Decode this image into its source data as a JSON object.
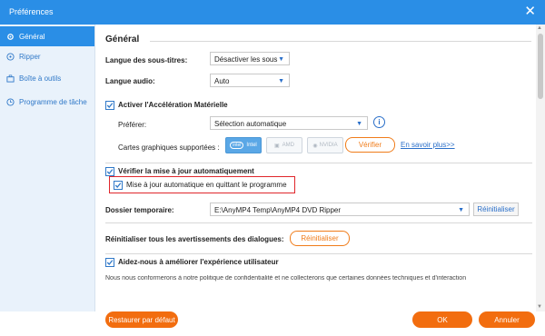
{
  "window": {
    "title": "Préférences",
    "close_icon": "close-icon"
  },
  "sidebar": {
    "items": [
      {
        "label": "Général",
        "icon": "gear-icon",
        "active": true
      },
      {
        "label": "Ripper",
        "icon": "disc-icon",
        "active": false
      },
      {
        "label": "Boîte à outils",
        "icon": "toolbox-icon",
        "active": false
      },
      {
        "label": "Programme de tâche",
        "icon": "clock-icon",
        "active": false
      }
    ]
  },
  "general": {
    "section_title": "Général",
    "subtitle_lang_label": "Langue des sous-titres:",
    "subtitle_lang_value": "Désactiver les sous",
    "audio_lang_label": "Langue audio:",
    "audio_lang_value": "Auto",
    "hw_accel_label": "Activer l'Accélération Matérielle",
    "prefer_label": "Préférer:",
    "prefer_value": "Sélection automatique",
    "gpu_label": "Cartes graphiques supportées :",
    "gpu_intel": "Intel",
    "gpu_amd": "AMD",
    "gpu_nvidia": "NVIDIA",
    "verify_button": "Vérifier",
    "learn_more": "En savoir plus>>",
    "auto_update_label": "Vérifier la mise à jour automatiquement",
    "update_on_quit_label": "Mise à jour automatique en quittant le programme",
    "temp_folder_label": "Dossier temporaire:",
    "temp_folder_value": "E:\\AnyMP4 Temp\\AnyMP4 DVD Ripper",
    "reset_small_button": "Réinitialiser",
    "reset_warnings_label": "Réinitialiser tous les avertissements des dialogues:",
    "reset_button": "Réinitialiser",
    "improve_label": "Aidez-nous à améliorer l'expérience utilisateur",
    "improve_desc": "Nous nous conformerons à notre politique de confidentialité et ne collecterons que certaines données techniques et d'interaction"
  },
  "footer": {
    "restore_default": "Restaurer par défaut",
    "ok": "OK",
    "cancel": "Annuler"
  },
  "colors": {
    "accent_blue": "#2a8ee6",
    "accent_orange": "#f26d0f",
    "highlight_red": "#e0262b"
  }
}
